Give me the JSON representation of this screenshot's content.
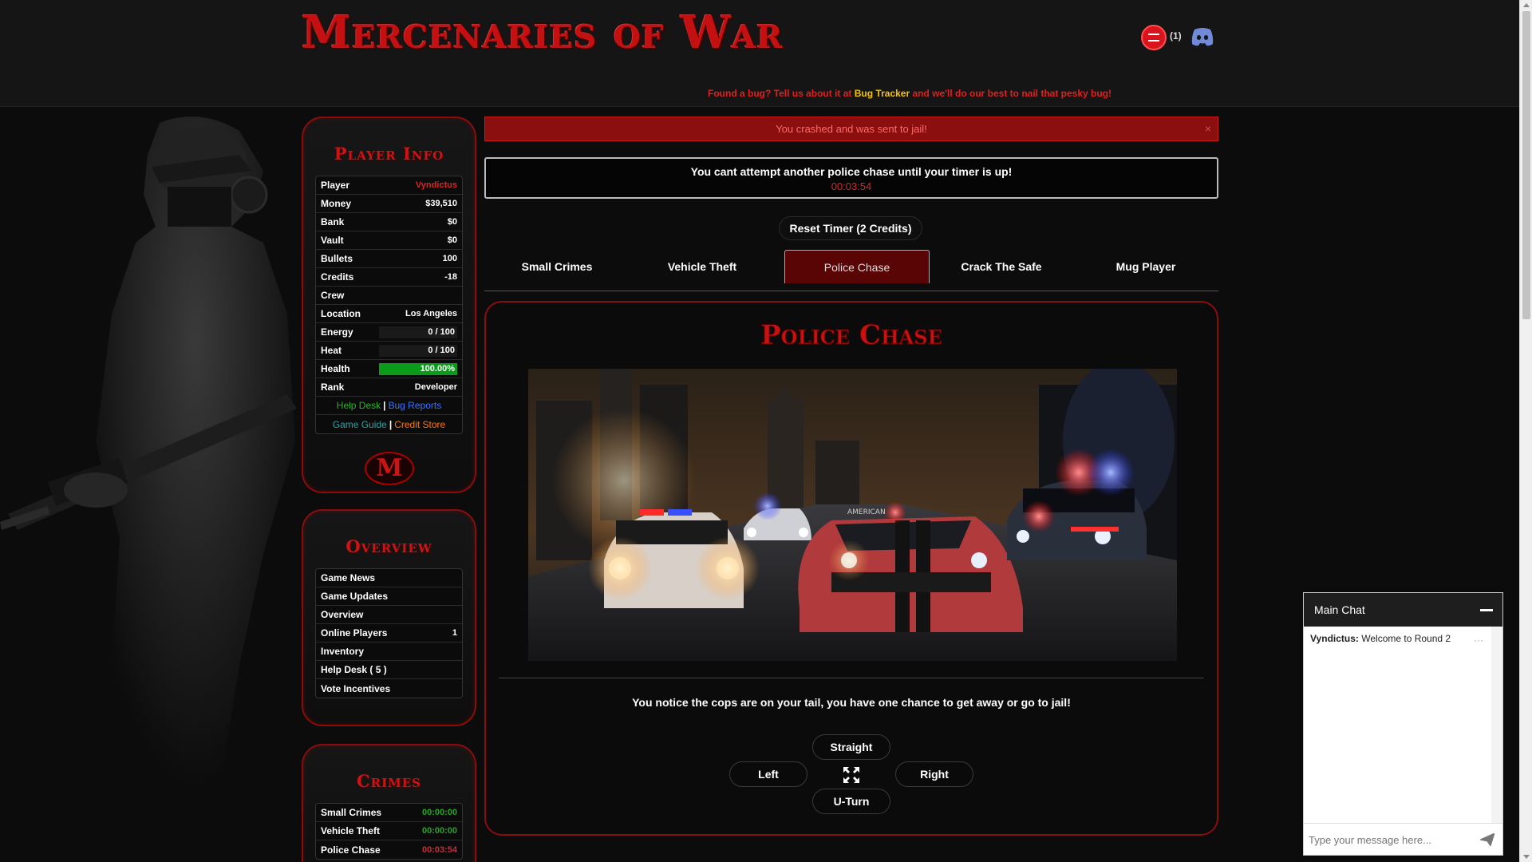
{
  "header": {
    "logo_text": "Mercenaries of War",
    "chat_count": "(1)",
    "bug_notice_pre": "Found a bug? Tell us about it at ",
    "bug_notice_link": "Bug Tracker",
    "bug_notice_post": " and we'll do our best to nail that pesky bug!"
  },
  "player_info": {
    "title": "Player Info",
    "rows": [
      {
        "label": "Player",
        "value": "Vyndictus"
      },
      {
        "label": "Money",
        "value": "$39,510"
      },
      {
        "label": "Bank",
        "value": "$0"
      },
      {
        "label": "Vault",
        "value": "$0"
      },
      {
        "label": "Bullets",
        "value": "100"
      },
      {
        "label": "Credits",
        "value": "-18"
      },
      {
        "label": "Crew",
        "value": ""
      },
      {
        "label": "Location",
        "value": "Los Angeles"
      },
      {
        "label": "Energy",
        "value": "0 / 100",
        "fill": 0
      },
      {
        "label": "Heat",
        "value": "0 / 100",
        "fill": 0
      },
      {
        "label": "Health",
        "value": "100.00%",
        "fill": 1.0
      },
      {
        "label": "Rank",
        "value": "Developer"
      }
    ],
    "links": {
      "help_desk": "Help Desk",
      "bug_reports": "Bug Reports",
      "game_guide": "Game Guide",
      "credit_store": "Credit Store",
      "separator": "|"
    },
    "emblem": "M"
  },
  "overview": {
    "title": "Overview",
    "items": [
      {
        "label": "Game News",
        "value": ""
      },
      {
        "label": "Game Updates",
        "value": ""
      },
      {
        "label": "Overview",
        "value": ""
      },
      {
        "label": "Online Players",
        "value": "1"
      },
      {
        "label": "Inventory",
        "value": ""
      },
      {
        "label": "Help Desk ( 5 )",
        "value": ""
      },
      {
        "label": "Vote Incentives",
        "value": ""
      }
    ]
  },
  "crimes": {
    "title": "Crimes",
    "items": [
      {
        "label": "Small Crimes",
        "timer": "00:00:00"
      },
      {
        "label": "Vehicle Theft",
        "timer": "00:00:00"
      },
      {
        "label": "Police Chase",
        "timer": "00:03:54"
      }
    ]
  },
  "alert": {
    "message": "You crashed and was sent to jail!",
    "close": "×"
  },
  "timer_box": {
    "message": "You cant attempt another police chase until your timer is up!",
    "time": "00:03:54"
  },
  "reset_button": "Reset Timer (2 Credits)",
  "tabs": [
    "Small Crimes",
    "Vehicle Theft",
    "Police Chase",
    "Crack The Safe",
    "Mug Player"
  ],
  "active_tab": "Police Chase",
  "chase": {
    "title": "Police Chase",
    "description": "You notice the cops are on your tail, you have one chance to get away or go to jail!",
    "buttons": {
      "straight": "Straight",
      "left": "Left",
      "right": "Right",
      "uturn": "U-Turn"
    },
    "sign_text": "AMERICAN"
  },
  "chat": {
    "title": "Main Chat",
    "messages": [
      {
        "user": "Vyndictus:",
        "text": " Welcome to Round 2"
      }
    ],
    "more": "···",
    "placeholder": "Type your message here..."
  },
  "colors": {
    "accent_red": "#c41010",
    "panel_border": "#8a0d0d",
    "alert_bg": "#8b0f0f",
    "health_green": "#0b9b1a"
  }
}
